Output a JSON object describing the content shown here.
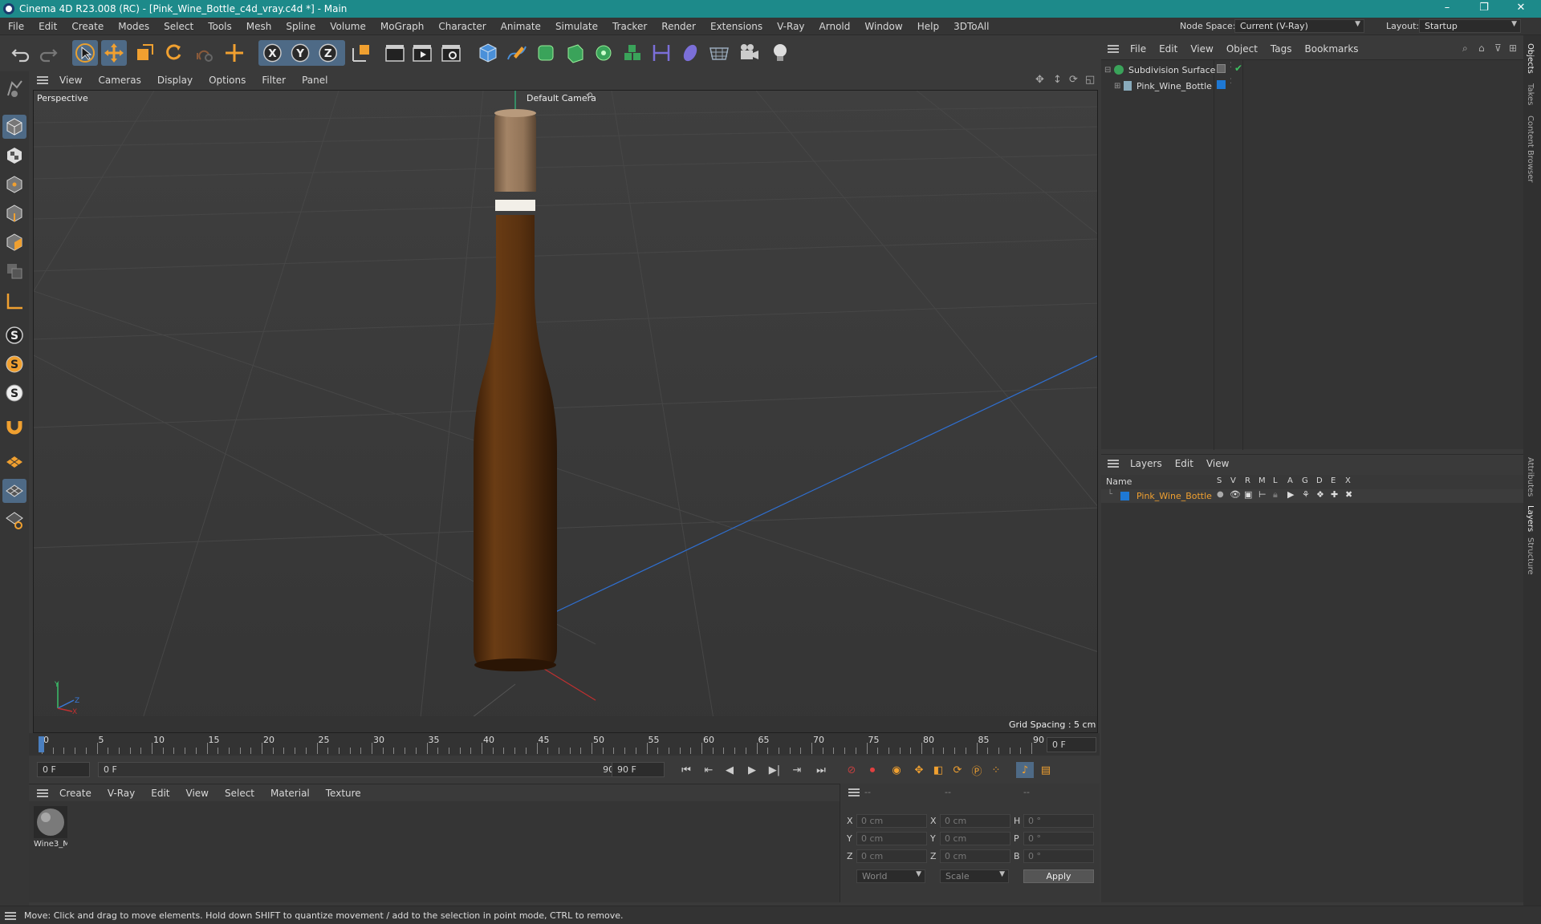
{
  "app": {
    "title": "Cinema 4D R23.008 (RC) - [Pink_Wine_Bottle_c4d_vray.c4d *] - Main",
    "window_controls": [
      "–",
      "❐",
      "✕"
    ]
  },
  "menubar": {
    "items": [
      "File",
      "Edit",
      "Create",
      "Modes",
      "Select",
      "Tools",
      "Mesh",
      "Spline",
      "Volume",
      "MoGraph",
      "Character",
      "Animate",
      "Simulate",
      "Tracker",
      "Render",
      "Extensions",
      "V-Ray",
      "Arnold",
      "Window",
      "Help",
      "3DToAll"
    ],
    "node_space_label": "Node Space:",
    "node_space_value": "Current (V-Ray)",
    "layout_label": "Layout:",
    "layout_value": "Startup"
  },
  "viewport": {
    "menu": [
      "View",
      "Cameras",
      "Display",
      "Options",
      "Filter",
      "Panel"
    ],
    "view_name": "Perspective",
    "camera_name": "Default Camera",
    "grid_spacing": "Grid Spacing : 5 cm",
    "axis_labels": {
      "y": "Y",
      "z": "Z",
      "x": "X"
    }
  },
  "timeline": {
    "ticks": [
      "0",
      "5",
      "10",
      "15",
      "20",
      "25",
      "30",
      "35",
      "40",
      "45",
      "50",
      "55",
      "60",
      "65",
      "70",
      "75",
      "80",
      "85",
      "90"
    ],
    "current_frame_display": "0 F",
    "start_field": "0 F",
    "range_start": "0 F",
    "range_end": "90 F",
    "end_field": "90 F"
  },
  "material_manager": {
    "menu": [
      "Create",
      "V-Ray",
      "Edit",
      "View",
      "Select",
      "Material",
      "Texture"
    ],
    "materials": [
      {
        "name": "Wine3_M"
      }
    ]
  },
  "coordinates": {
    "headers": [
      "--",
      "--",
      "--"
    ],
    "rows": [
      {
        "l1": "X",
        "v1": "0 cm",
        "l2": "X",
        "v2": "0 cm",
        "l3": "H",
        "v3": "0 °"
      },
      {
        "l1": "Y",
        "v1": "0 cm",
        "l2": "Y",
        "v2": "0 cm",
        "l3": "P",
        "v3": "0 °"
      },
      {
        "l1": "Z",
        "v1": "0 cm",
        "l2": "Z",
        "v2": "0 cm",
        "l3": "B",
        "v3": "0 °"
      }
    ],
    "mode_dropdown": "World",
    "scale_dropdown": "Scale",
    "apply_label": "Apply"
  },
  "object_manager": {
    "menu": [
      "File",
      "Edit",
      "View",
      "Object",
      "Tags",
      "Bookmarks"
    ],
    "objects": [
      {
        "name": "Subdivision Surface"
      },
      {
        "name": "Pink_Wine_Bottle"
      }
    ]
  },
  "layer_manager": {
    "menu": [
      "Layers",
      "Edit",
      "View"
    ],
    "header": {
      "name": "Name",
      "flags": [
        "S",
        "V",
        "R",
        "M",
        "L",
        "A",
        "G",
        "D",
        "E",
        "X"
      ]
    },
    "layers": [
      {
        "name": "Pink_Wine_Bottle",
        "color": "#1e78d4"
      }
    ]
  },
  "side_tabs": [
    "Objects",
    "Takes",
    "Content Browser",
    "Attributes",
    "Layers",
    "Structure"
  ],
  "status": {
    "message": "Move: Click and drag to move elements. Hold down SHIFT to quantize movement / add to the selection in point mode, CTRL to remove."
  },
  "colors": {
    "accent_teal": "#1d8a8a",
    "active_blue": "#4e6a86",
    "icon_orange": "#f0a030",
    "bottle_brown": "#5a3210",
    "cap_tan": "#9a7a5a"
  }
}
